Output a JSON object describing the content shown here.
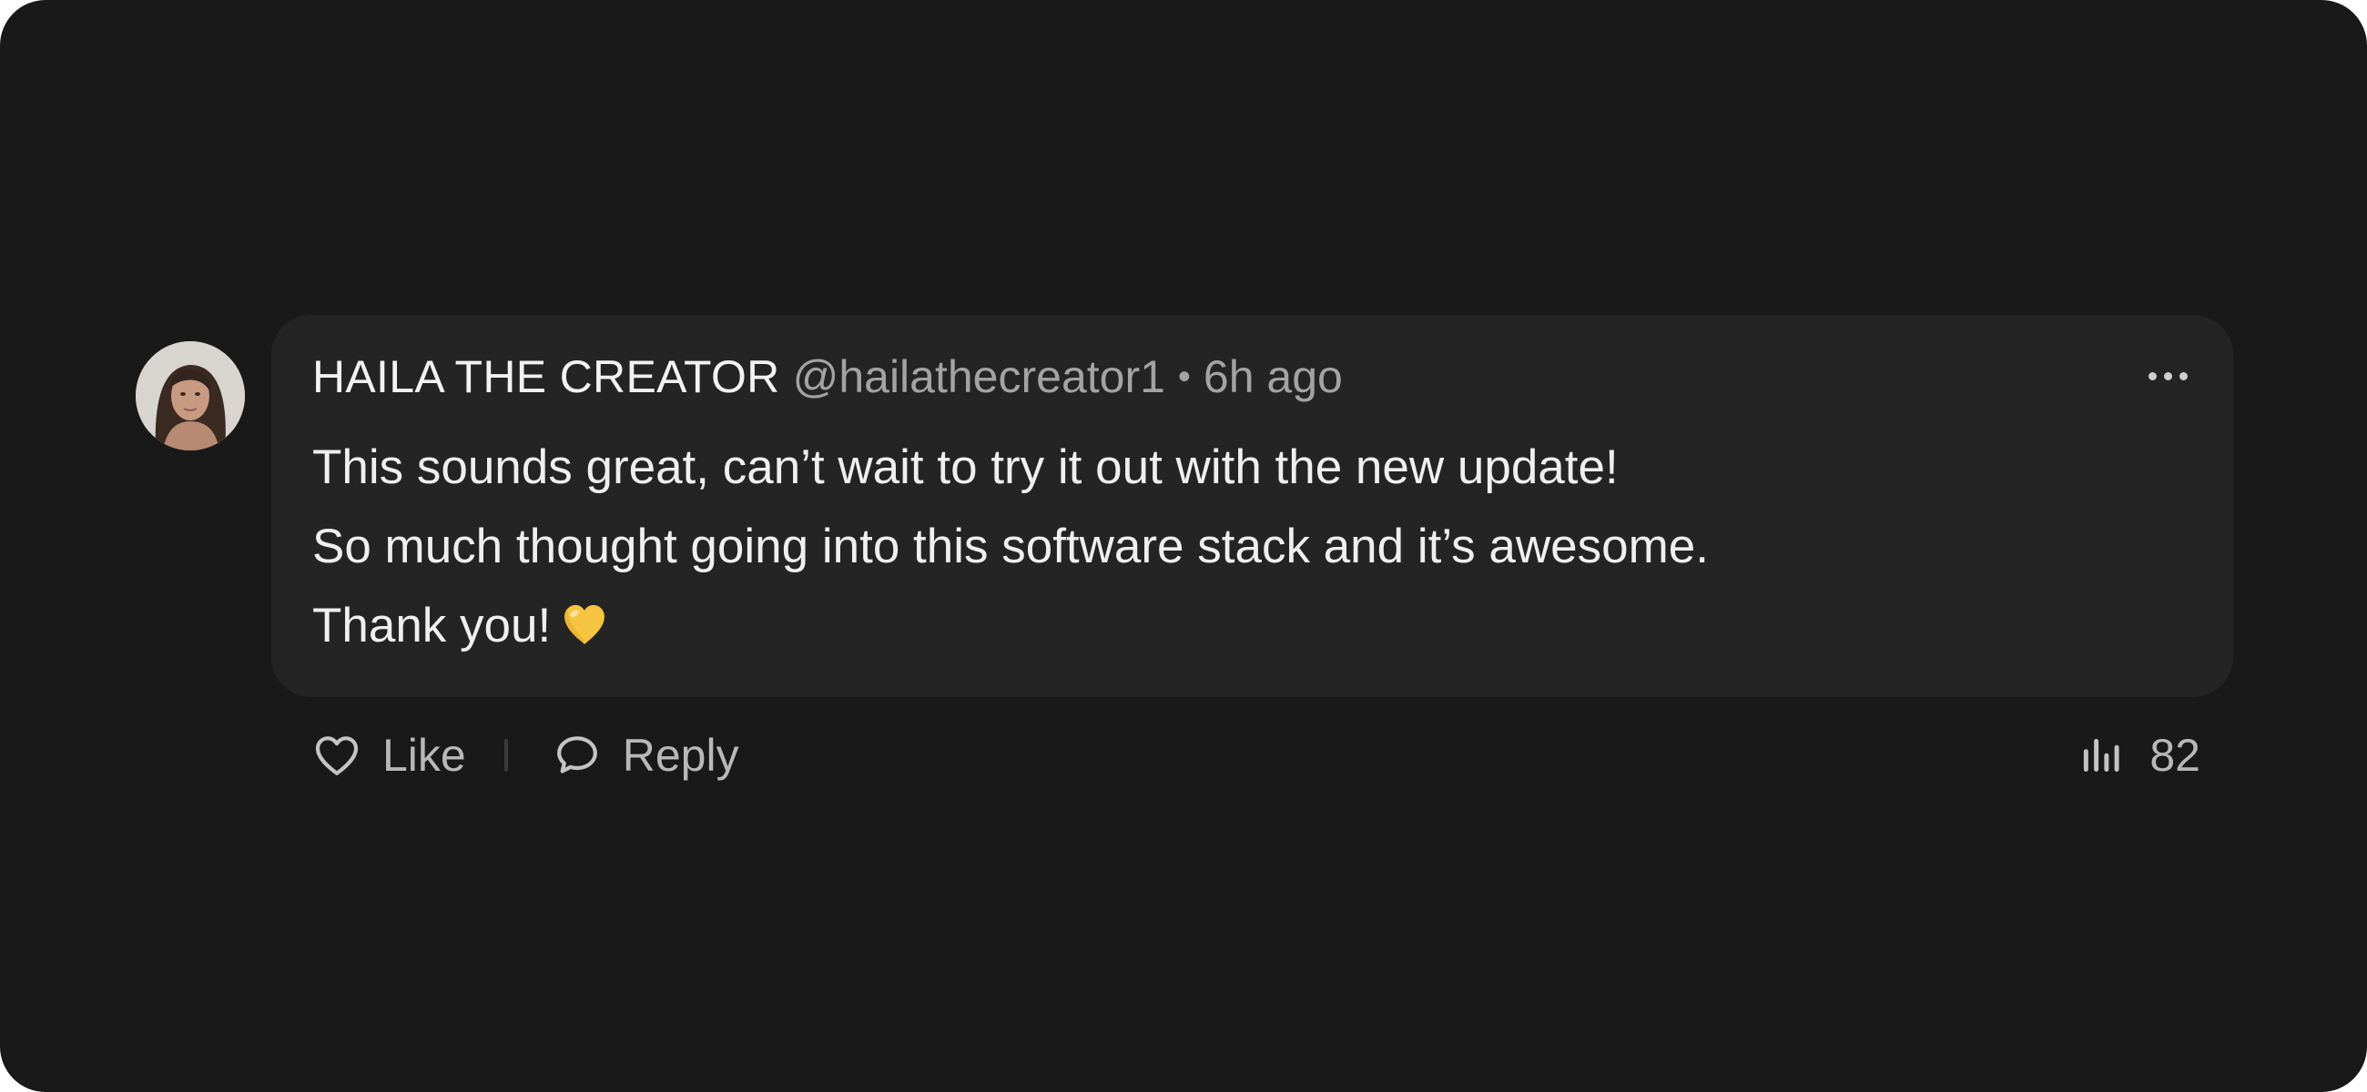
{
  "comment": {
    "author": {
      "name": "HAILA THE CREATOR",
      "handle": "@hailathecreator1"
    },
    "separator": "•",
    "timestamp": "6h ago",
    "body_lines": [
      "This sounds great, can’t wait to try it out with the new update!",
      "So much thought going into this software stack and it’s awesome.",
      "Thank you!"
    ],
    "emoji": "yellow-heart"
  },
  "actions": {
    "like_label": "Like",
    "reply_label": "Reply"
  },
  "stats": {
    "views": "82",
    "icon": "bar-chart-icon"
  },
  "colors": {
    "background": "#191919",
    "bubble": "#242424",
    "primary_text": "#efefef",
    "secondary_text": "#a3a3a3",
    "emoji_yellow": "#f5c542"
  }
}
